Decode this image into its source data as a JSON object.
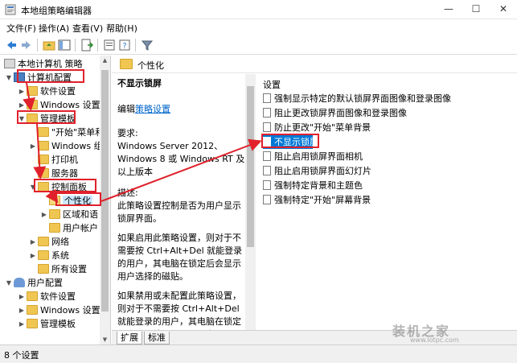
{
  "window": {
    "title": "本地组策略编辑器",
    "minimize": "—",
    "maximize": "☐",
    "close": "✕"
  },
  "menu": [
    "文件(F)",
    "操作(A)",
    "查看(V)",
    "帮助(H)"
  ],
  "tree": {
    "root": "本地计算机 策略",
    "computer_config": "计算机配置",
    "software_settings": "软件设置",
    "windows_settings": "Windows 设置",
    "admin_templates": "管理模板",
    "start_menu": "\"开始\"菜单和",
    "windows_comp": "Windows 组",
    "printers": "打印机",
    "server": "服务器",
    "control_panel": "控制面板",
    "personalization": "个性化",
    "region": "区域和语",
    "user_accounts": "用户帐户",
    "network": "网络",
    "system": "系统",
    "all_settings": "所有设置",
    "user_config": "用户配置",
    "u_software": "软件设置",
    "u_windows": "Windows 设置",
    "u_admin": "管理模板"
  },
  "right_header": "个性化",
  "description": {
    "title": "不显示锁屏",
    "edit_prefix": "编辑",
    "edit_link": "策略设置",
    "requirements_label": "要求:",
    "requirements": "Windows Server 2012、Windows 8 或 Windows RT 及以上版本",
    "desc_label": "描述:",
    "desc": "此策略设置控制是否为用户显示锁屏界面。",
    "enabled": "如果启用此策略设置，则对于不需要按 Ctrl+Alt+Del 就能登录的用户，其电脑在锁定后会显示用户选择的磁贴。",
    "disabled": "如果禁用或未配置此策略设置，则对于不需要按 Ctrl+Alt+Del 就能登录的用户，其电脑在锁定后会显示锁屏界面，用户必须通过关闭"
  },
  "settings": {
    "header": "设置",
    "items": [
      "强制显示特定的默认锁屏界面图像和登录图像",
      "阻止更改锁屏界面图像和登录图像",
      "防止更改\"开始\"菜单背景",
      "不显示锁屏",
      "阻止启用锁屏界面相机",
      "阻止启用锁屏界面幻灯片",
      "强制特定背景和主题色",
      "强制特定\"开始\"屏幕背景"
    ]
  },
  "tabs": {
    "extended": "扩展",
    "standard": "标准"
  },
  "status": "8 个设置",
  "watermark": {
    "text": "装机之家",
    "url": "www.lotpc.com"
  },
  "colors": {
    "accent": "#0078d7",
    "highlight_red": "#e0212b"
  }
}
